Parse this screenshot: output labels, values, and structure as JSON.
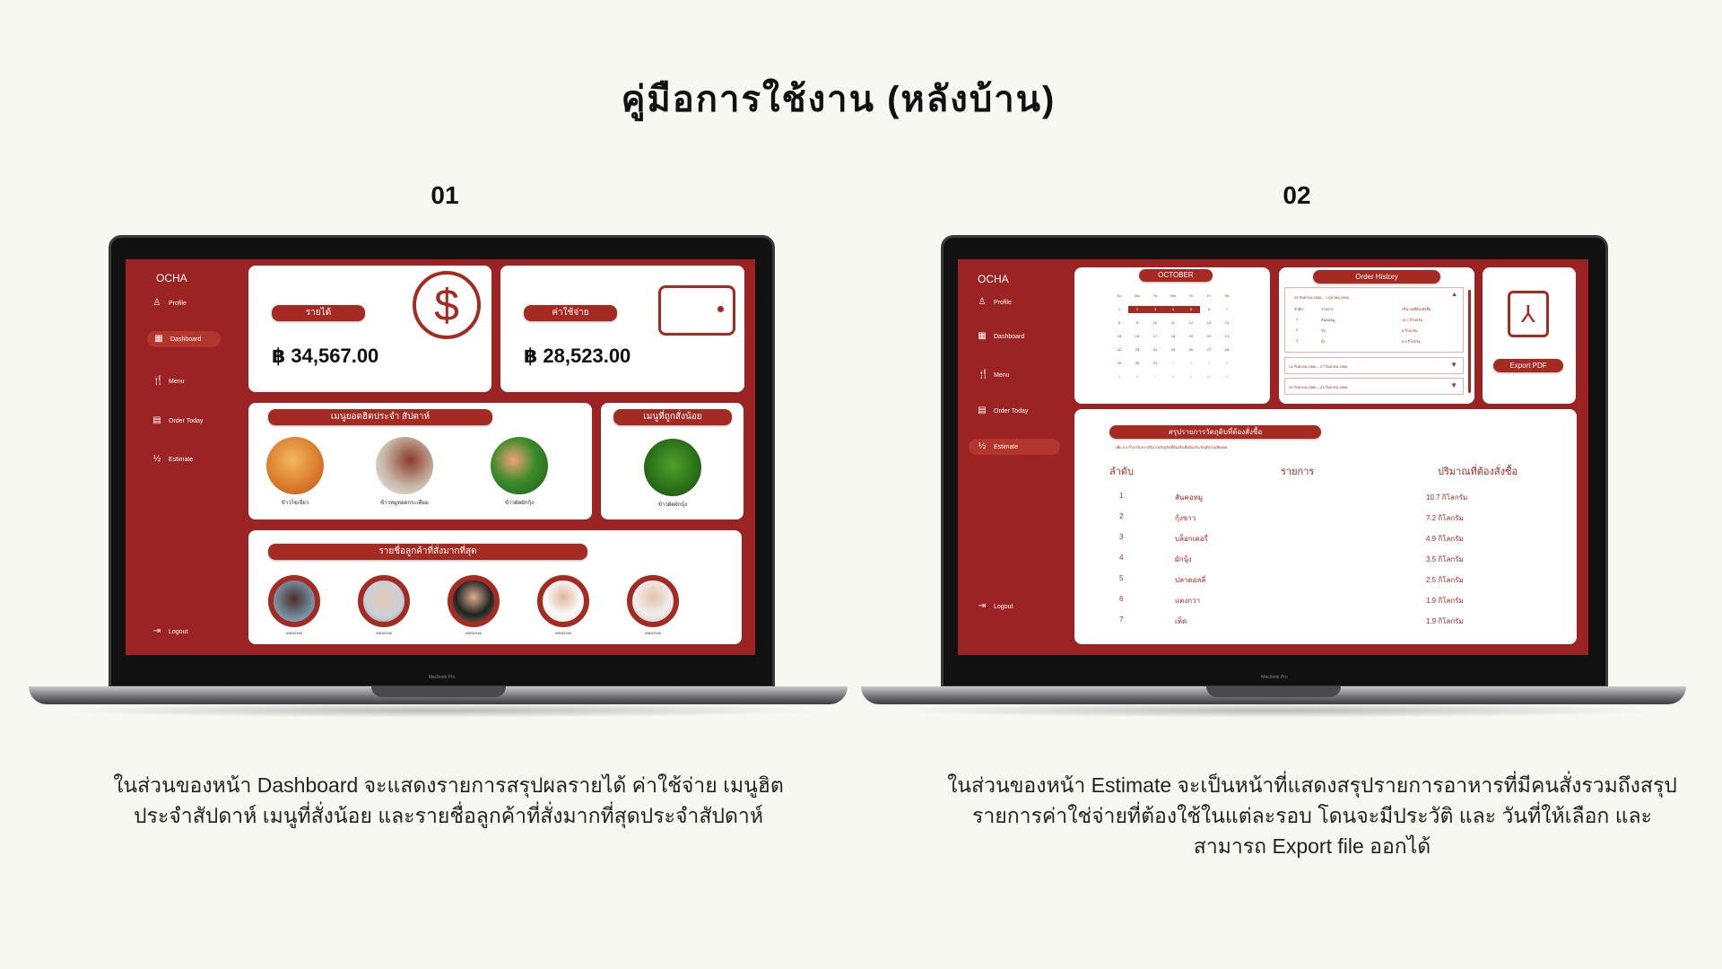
{
  "title": "คู่มือการใช้งาน (หลังบ้าน)",
  "section1": {
    "number": "01",
    "caption": "ในส่วนของหน้า Dashboard จะแสดงรายการสรุปผลรายได้ ค่าใช้จ่าย เมนูฮิตประจำสัปดาห์ เมนูที่สั่งน้อย และรายชื่อลูกค้าที่สั่งมากที่สุดประจำสัปดาห์"
  },
  "section2": {
    "number": "02",
    "caption": "ในส่วนของหน้า Estimate จะเป็นหน้าที่แสดงสรุปรายการอาหารที่มีคนสั่งรวมถึงสรุปรายการค่าใช่จ่ายที่ต้องใช้ในแต่ละรอบ โดนจะมีประวัติ และ วันที่ให้เลือก และสามารถ Export file ออกได้"
  },
  "laptop_label": "Macbook Pro",
  "app": {
    "logo": "OCHA",
    "nav": [
      "Profile",
      "Dashboard",
      "Menu",
      "Order Today",
      "Estimate",
      "Logout"
    ]
  },
  "dashboard": {
    "income": {
      "label": "รายได้",
      "value": "฿ 34,567.00"
    },
    "expense": {
      "label": "ค่าใช้จ่าย",
      "value": "฿ 28,523.00"
    },
    "hot_menu": {
      "title": "เมนูยอดฮิตประจำ สัปดาห์",
      "items": [
        "ข้าวไข่เจียว",
        "ข้าวหมูทอดกระเทียม",
        "ข้าวผัดผักกุ้ง"
      ]
    },
    "least_menu": {
      "title": "เมนูที่ถูกสั่งน้อย",
      "items": [
        "ข้าวผัดผักบุ้ง"
      ]
    },
    "customers": {
      "title": "รายชื่อลูกค้าที่สั่งมากที่สุด",
      "ids": [
        "#5632946",
        "#5632946",
        "#5632946",
        "#5632946",
        "#5632946"
      ]
    }
  },
  "estimate": {
    "calendar": {
      "month": "OCTOBER",
      "weekdays": [
        "Su",
        "Mo",
        "Tu",
        "We",
        "Th",
        "Fr",
        "Sa"
      ],
      "days": [
        "1",
        "2",
        "3",
        "4",
        "5",
        "6",
        "7",
        "8",
        "9",
        "10",
        "11",
        "12",
        "13",
        "14",
        "15",
        "16",
        "17",
        "18",
        "19",
        "20",
        "21",
        "22",
        "23",
        "24",
        "25",
        "26",
        "27",
        "28",
        "29",
        "30",
        "31",
        "1",
        "2",
        "3",
        "4",
        "5",
        "6",
        "7",
        "8",
        "9",
        "10",
        "11"
      ],
      "selected": [
        "2",
        "3",
        "4",
        "5"
      ]
    },
    "order_history": {
      "title": "Order History",
      "open": {
        "range": "28 กันยายน 2566  –  1 ตุลาคม 2566",
        "headers": [
          "ลำดับ",
          "รายการ",
          "ปริมาณที่ต้องสั่งซื้อ"
        ],
        "rows": [
          [
            "1",
            "สันคอหมู",
            "10.7 กิโลกรัม"
          ],
          [
            "2",
            "ไข่",
            "6 กิโลกรัม"
          ],
          [
            "3",
            "กุ้ง",
            "5.5 กิโลกรัม"
          ]
        ]
      },
      "collapsed": [
        "24 กันยายน 2566  –  27 กันยายน 2566",
        "20 กันยายน 2566  –  23 กันยายน 2566"
      ]
    },
    "export_label": "Export PDF",
    "summary": {
      "title": "สรุปรายการวัตถุดิบที่ต้องสั่งซื้อ",
      "note": "เพิ่ม 0.5 กิโลกรัมจากปริมาณวัตถุดิบที่ต้องสั่งเพื่อป้องกันวัตถุดิบไม่เพียงพอ",
      "headers": [
        "ลำดับ",
        "รายการ",
        "ปริมาณที่ต้องสั่งซื้อ"
      ],
      "rows": [
        [
          "1",
          "สันคอหมู",
          "10.7 กิโลกรัม"
        ],
        [
          "2",
          "กุ้งขาว",
          "7.2 กิโลกรัม"
        ],
        [
          "3",
          "บล็อกเคอรี่",
          "4.9 กิโลกรัม"
        ],
        [
          "4",
          "ผักบุ้ง",
          "3.5 กิโลกรัม"
        ],
        [
          "5",
          "ปลาดอลลี่",
          "2.5 กิโลกรัม"
        ],
        [
          "6",
          "แตงกวา",
          "1.9 กิโลกรัม"
        ],
        [
          "7",
          "เห็ด",
          "1.9 กิโลกรัม"
        ]
      ]
    }
  },
  "colors": {
    "brand": "#9b2323",
    "pill": "#a52a22",
    "background": "#f8f8f3"
  }
}
